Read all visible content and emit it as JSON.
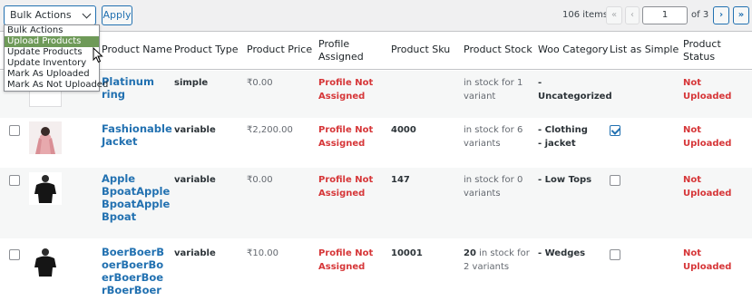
{
  "toolbar": {
    "bulk_select_value": "Bulk Actions",
    "apply_label": "Apply",
    "items_count": "106 items",
    "first_page": "«",
    "prev_page": "‹",
    "page_value": "1",
    "of_pages": "of 3",
    "next_page": "›",
    "last_page": "»"
  },
  "bulk_menu": {
    "options": [
      "Bulk Actions",
      "Upload Products",
      "Update Products",
      "Update Inventory",
      "Mark As Uploaded",
      "Mark As Not Uploaded"
    ],
    "highlighted": "Upload Products"
  },
  "columns": [
    "Product Name",
    "Product Type",
    "Product Price",
    "Profile Assigned",
    "Product Sku",
    "Product Stock",
    "Woo Category",
    "List as Simple",
    "Product Status"
  ],
  "rows": [
    {
      "name": "Platinum ring",
      "type": "simple",
      "price": "₹0.00",
      "profile": "Profile Not Assigned",
      "sku": "",
      "stock": "in stock for 1 variant",
      "stock_num": "",
      "category": "- Uncategorized",
      "list_simple": null,
      "status": "Not Uploaded"
    },
    {
      "name": "Fashionable Jacket",
      "type": "variable",
      "price": "₹2,200.00",
      "profile": "Profile Not Assigned",
      "sku": "4000",
      "stock": "in stock for 6 variants",
      "stock_num": "",
      "category": "- Clothing - jacket",
      "list_simple": true,
      "status": "Not Uploaded"
    },
    {
      "name": "Apple BpoatApple BpoatApple Bpoat",
      "type": "variable",
      "price": "₹0.00",
      "profile": "Profile Not Assigned",
      "sku": "147",
      "stock": "in stock for 0 variants",
      "stock_num": "",
      "category": "- Low Tops",
      "list_simple": false,
      "status": "Not Uploaded"
    },
    {
      "name": "BoerBoerBoerBoerBoerBoerBoerBoerBoer",
      "type": "variable",
      "price": "₹10.00",
      "profile": "Profile Not Assigned",
      "sku": "10001",
      "stock": "in stock for 2 variants",
      "stock_num": "20",
      "category": "- Wedges",
      "list_simple": false,
      "status": "Not Uploaded"
    }
  ],
  "colors": {
    "accent": "#2271b1",
    "danger": "#d63638",
    "menu_highlight": "#6e9a58"
  }
}
